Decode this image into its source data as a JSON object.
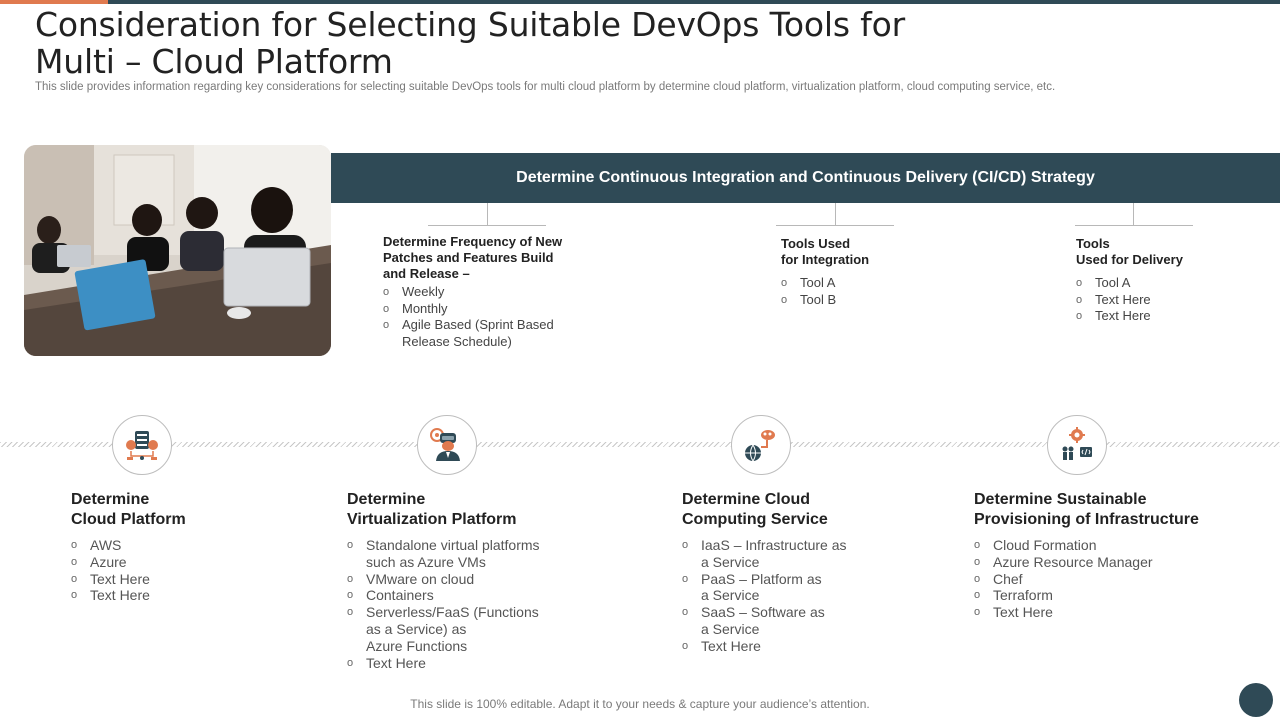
{
  "slide": {
    "title": "Consideration for Selecting Suitable DevOps Tools for Multi – Cloud Platform",
    "subtitle": "This slide provides information regarding key considerations for selecting suitable DevOps tools for multi cloud platform by determine cloud platform, virtualization platform, cloud computing service, etc.",
    "footer": "This slide is 100% editable. Adapt it to your needs & capture your audience’s attention."
  },
  "banner": {
    "label": "Determine Continuous Integration and Continuous Delivery (CI/CD) Strategy"
  },
  "cicd": [
    {
      "heading": "Determine Frequency of New\nPatches and Features Build\nand Release –",
      "items": [
        "Weekly",
        "Monthly",
        "Agile Based (Sprint Based\nRelease Schedule)"
      ]
    },
    {
      "heading": "Tools Used\nfor Integration",
      "items": [
        "Tool A",
        "Tool B"
      ]
    },
    {
      "heading": "Tools\nUsed for Delivery",
      "items": [
        "Tool A",
        "Text Here",
        "Text Here"
      ]
    }
  ],
  "considerations": [
    {
      "icon": "server-cloud-icon",
      "heading": "Determine\nCloud Platform",
      "items": [
        "AWS",
        "Azure",
        "Text Here",
        "Text Here"
      ]
    },
    {
      "icon": "vr-engineer-icon",
      "heading": "Determine\nVirtualization Platform",
      "items": [
        "Standalone virtual platforms\nsuch as Azure VMs",
        "VMware on cloud",
        "Containers",
        "Serverless/FaaS (Functions\nas a Service) as\nAzure Functions",
        "Text Here"
      ]
    },
    {
      "icon": "globe-cloud-network-icon",
      "heading": "Determine Cloud\nComputing Service",
      "items": [
        "IaaS – Infrastructure as\na Service",
        "PaaS – Platform as\na Service",
        "SaaS – Software as\na Service",
        "Text Here"
      ]
    },
    {
      "icon": "gear-people-code-icon",
      "heading": "Determine Sustainable\nProvisioning of Infrastructure",
      "items": [
        "Cloud Formation",
        "Azure Resource Manager",
        "Chef",
        "Terraform",
        "Text Here"
      ]
    }
  ],
  "colors": {
    "primary": "#2f4a56",
    "accent": "#e07a4f"
  }
}
